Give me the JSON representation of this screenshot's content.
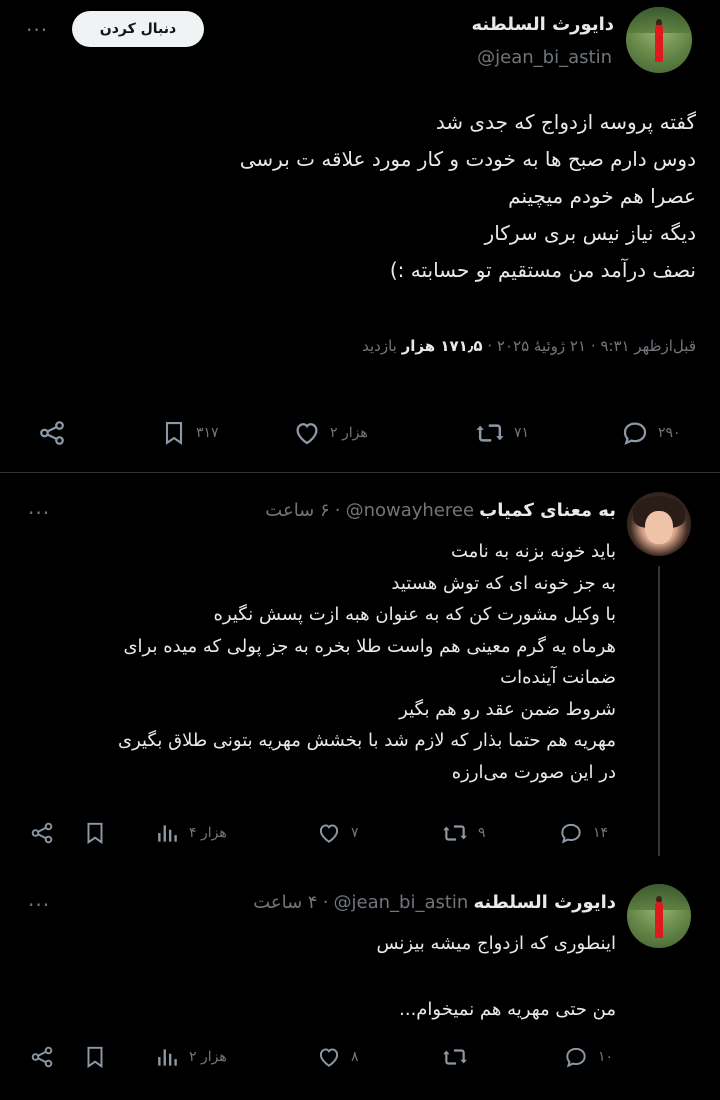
{
  "main_tweet": {
    "author_name": "دایورث السلطنه",
    "handle": "@jean_bi_astin",
    "follow_label": "دنبال کردن",
    "more": "···",
    "lines": [
      "گفته پروسه ازدواج که جدی شد",
      "دوس دارم صبح ها به خودت و کار مورد علاقه ت برسی",
      "عصرا هم خودم میچینم",
      "دیگه نیاز نیس بری سرکار",
      "نصف درآمد من مستقیم تو حسابته :)"
    ],
    "time": "قبل‌ازظهر ۹:۳۱",
    "date": "۲۱ ژوئیهٔ ۲۰۲۵",
    "views_count": "۱۷۱٫۵ هزار",
    "views_label": "بازدید",
    "sep": "·",
    "actions": {
      "replies": "۲۹۰",
      "retweets": "۷۱",
      "likes": "۲ هزار",
      "bookmarks": "۳۱۷"
    }
  },
  "reply1": {
    "author_name": "به معنای کمیاب",
    "handle": "@nowayheree",
    "time": "۶ ساعت",
    "sep": "·",
    "more": "···",
    "lines": [
      "باید خونه بزنه به نامت",
      "به جز خونه ای که توش هستید",
      "با وکیل مشورت کن که به عنوان هبه ازت پسش نگیره",
      "هرماه یه گرم معینی هم واست طلا بخره به جز پولی که میده برای",
      "ضمانت آینده‌ات",
      " شروط ضمن عقد رو هم بگیر",
      "مهریه هم حتما بذار که لازم شد با بخشش مهریه بتونی طلاق بگیری",
      "در این صورت می‌ارزه"
    ],
    "actions": {
      "replies": "۱۴",
      "retweets": "۹",
      "likes": "۷",
      "views": "۴ هزار"
    }
  },
  "reply2": {
    "author_name": "دایورث السلطنه",
    "handle": "@jean_bi_astin",
    "time": "۴ ساعت",
    "sep": "·",
    "more": "···",
    "line1": "اینطوری که ازدواج میشه بیزنس",
    "line2": "من حتی مهریه هم نمیخوام...",
    "actions": {
      "replies": "۱۰",
      "retweets": "",
      "likes": "۸",
      "views": "۲ هزار"
    }
  },
  "colors": {
    "background": "#000000",
    "text": "#e7e9ea",
    "muted": "#71767b",
    "divider": "#2f3336"
  }
}
